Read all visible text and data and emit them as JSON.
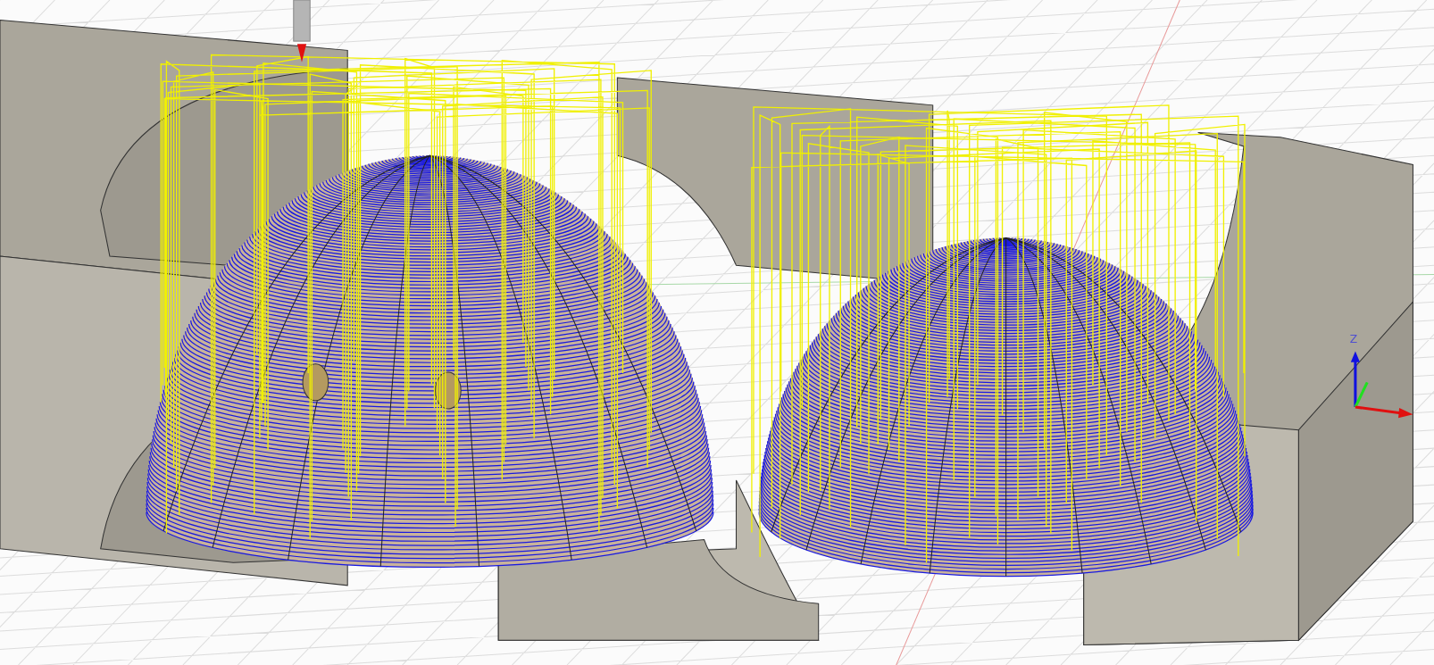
{
  "viewport": {
    "axis_triad": {
      "z_label": "Z"
    }
  }
}
